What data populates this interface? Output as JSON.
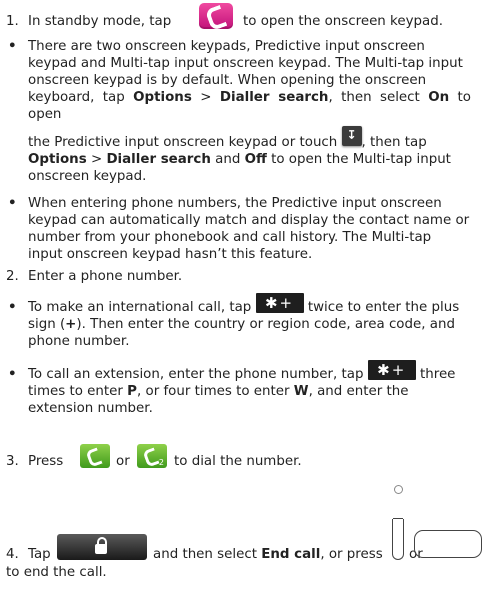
{
  "step1": {
    "num": "1.",
    "before": "In standby mode, tap",
    "after": "to open the onscreen keypad."
  },
  "bullet_keypads": {
    "line1": "There are two onscreen keypads, Predictive input onscreen",
    "line2": "keypad and Multi-tap input onscreen keypad. The Multi-tap input",
    "line3": "onscreen keypad is by default. When opening the onscreen",
    "line4a": "keyboard, tap",
    "options": "Options",
    "gt": ">",
    "dialler_search": "Dialler search",
    "line4b": ", then select",
    "on": "On",
    "line4c": "to open",
    "line5a": "the Predictive input onscreen keypad or touch",
    "line5b": ", then tap",
    "line6a": "and",
    "off": "Off",
    "line6b": "to open the Multi-tap input",
    "line7": "onscreen keypad."
  },
  "bullet_match": {
    "line1": "When entering phone numbers, the Predictive input onscreen",
    "line2": "keypad can automatically match and display the contact name or",
    "line3": "number from your phonebook and call history. The Multi-tap",
    "line4": "input onscreen keypad hasn’t this feature."
  },
  "step2": {
    "num": "2.",
    "text": "Enter a phone number."
  },
  "bullet_intl": {
    "line1a": "To make an international call, tap",
    "line1b": "twice to enter the plus",
    "line2a": "sign (",
    "plus": "+",
    "line2b": "). Then enter the country or region code, area code, and",
    "line3": "phone number."
  },
  "bullet_ext": {
    "line1a": "To call an extension, enter the phone number, tap",
    "line1b": "three",
    "line2a": "times to enter",
    "p": "P",
    "line2b": ", or four times to enter",
    "w": "W",
    "line2c": ", and enter the",
    "line3": "extension number."
  },
  "step3": {
    "num": "3.",
    "press": "Press",
    "or": "or",
    "after": "to dial the number.",
    "call2_sub": "2"
  },
  "step4": {
    "num": "4.",
    "tap": "Tap",
    "middle": "and then select",
    "end_call": "End call",
    "press": ", or press",
    "or": "or",
    "last": "to end the call."
  },
  "icons": {
    "phone_app": "pink-phone-app-icon",
    "download": "download-arrow-icon",
    "star_key": "star-plus-key-icon",
    "call1": "green-call-sim1-icon",
    "call2": "green-call-sim2-icon",
    "lock": "lock-screen-button-icon",
    "side_key": "side-power-key-icon",
    "end_key": "end-key-icon"
  },
  "glyphs": {
    "star_plus": "✱+",
    "download_arrow": "↧"
  }
}
